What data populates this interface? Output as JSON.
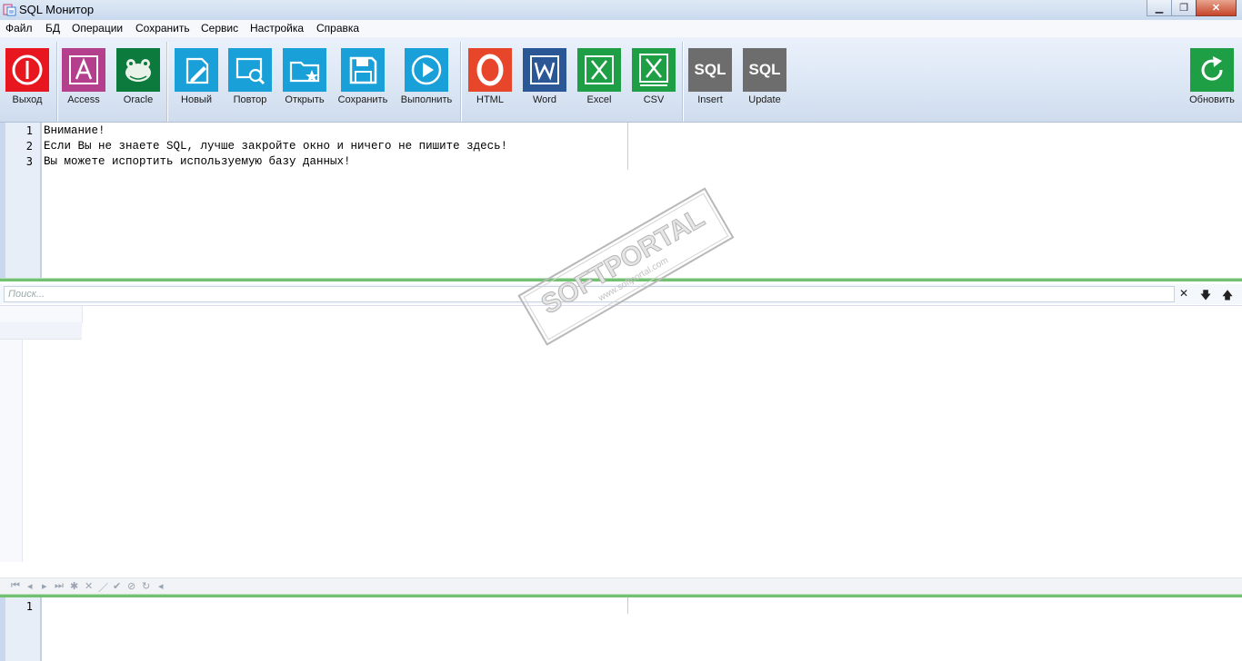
{
  "window": {
    "title": "SQL Монитор"
  },
  "menu": [
    "Файл",
    "БД",
    "Операции",
    "Сохранить",
    "Сервис",
    "Настройка",
    "Справка"
  ],
  "toolbar": {
    "buttons": [
      {
        "label": "Выход",
        "icon": "power-icon",
        "color": "#e8161f"
      },
      {
        "label": "Access",
        "icon": "access-icon",
        "color": "#b43f8c"
      },
      {
        "label": "Oracle",
        "icon": "frog-icon",
        "color": "#0c7a3c"
      },
      {
        "label": "Новый",
        "icon": "new-document-icon",
        "color": "#1aa0d8"
      },
      {
        "label": "Повтор",
        "icon": "search-window-icon",
        "color": "#1aa0d8"
      },
      {
        "label": "Открыть",
        "icon": "folder-star-icon",
        "color": "#1aa0d8"
      },
      {
        "label": "Сохранить",
        "icon": "save-icon",
        "color": "#1aa0d8"
      },
      {
        "label": "Выполнить",
        "icon": "play-icon",
        "color": "#1aa0d8"
      },
      {
        "label": "HTML",
        "icon": "opera-icon",
        "color": "#e8462a"
      },
      {
        "label": "Word",
        "icon": "word-icon",
        "color": "#2b5797"
      },
      {
        "label": "Excel",
        "icon": "excel-icon",
        "color": "#1e9f46"
      },
      {
        "label": "CSV",
        "icon": "csv-icon",
        "color": "#1e9f46"
      },
      {
        "label": "Insert",
        "icon": "sql-insert-icon",
        "color": "#6d6d6d",
        "tile_text": "SQL"
      },
      {
        "label": "Update",
        "icon": "sql-update-icon",
        "color": "#6d6d6d",
        "tile_text": "SQL"
      },
      {
        "label": "Обновить",
        "icon": "refresh-icon",
        "color": "#1e9f46"
      }
    ]
  },
  "editor": {
    "line_numbers": [
      "1",
      "2",
      "3"
    ],
    "lines": [
      "Внимание!",
      "Если Вы не знаете SQL, лучше закройте окно и ничего не пишите здесь!",
      "Вы можете испортить используемую базу данных!"
    ]
  },
  "search": {
    "placeholder": "Поиск..."
  },
  "bottom_editor": {
    "line_numbers": [
      "1"
    ]
  },
  "watermark": {
    "brand": "SOFTPORTAL",
    "url": "www.softportal.com"
  }
}
